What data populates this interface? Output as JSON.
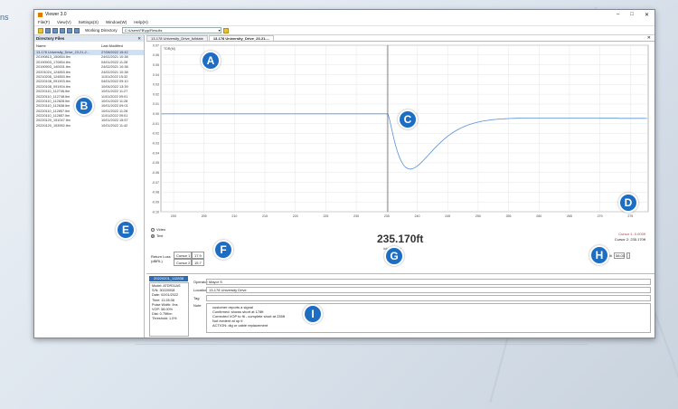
{
  "brand_fragment": "ns",
  "window": {
    "title": "Viewer 3.0",
    "controls": [
      "–",
      "□",
      "✕"
    ],
    "menu": [
      "File(F)",
      "View(V)",
      "Settings(S)",
      "Window(W)",
      "Help(H)"
    ],
    "working_dir_label": "Working Directory",
    "working_dir_value": "C:\\Users\\FB\\pp\\Results"
  },
  "sidebar": {
    "title": "Directory Files",
    "close": "✕",
    "col_name": "Name",
    "col_modified": "Last Modified",
    "files": [
      {
        "name": "13-178 University_Drive_23-21-2...",
        "date": "27/08/2022 15:42"
      },
      {
        "name": "20190813_150854.ltm",
        "date": "24/02/2021 10:38"
      },
      {
        "name": "20190903_170854.ltm",
        "date": "04/01/2022 11:28"
      },
      {
        "name": "20190903_140931.ltm",
        "date": "24/02/2021 10:38"
      },
      {
        "name": "20201024_124853.ltm",
        "date": "24/02/2021 10:38"
      },
      {
        "name": "20210206_124853.ltm",
        "date": "11/01/2022 15:32"
      },
      {
        "name": "20220108_091903.ltm",
        "date": "04/01/2022 09:10"
      },
      {
        "name": "20220108_091904.ltm",
        "date": "10/04/2022 13:39"
      },
      {
        "name": "20220110_112746.ltm",
        "date": "10/01/2022 11:27"
      },
      {
        "name": "20220110_112748.ltm",
        "date": "11/01/2022 09:01"
      },
      {
        "name": "20220110_112828.ltm",
        "date": "10/01/2022 11:28"
      },
      {
        "name": "20220110_112838.ltm",
        "date": "10/01/2022 09:01"
      },
      {
        "name": "20220110_112857.ltm",
        "date": "10/01/2022 11:28"
      },
      {
        "name": "20220110_112857.ltm",
        "date": "11/01/2022 09:01"
      },
      {
        "name": "20220120_151047.ltm",
        "date": "10/01/2022 15:57"
      },
      {
        "name": "20220120_153952.ltm",
        "date": "10/01/2022 11:42"
      }
    ]
  },
  "tabs": [
    {
      "label": "13-178 University_Drive_fulldate"
    },
    {
      "label": "13-178 University_Drive_23-21-..."
    }
  ],
  "tabs_close": "✕",
  "plot": {
    "corner_label": "TDR(M)",
    "y_ticks": [
      "0.07",
      "0.06",
      "0.05",
      "0.04",
      "0.03",
      "0.02",
      "0.01",
      "0.00",
      "-0.01",
      "-0.02",
      "-0.03",
      "-0.04",
      "-0.05",
      "-0.06",
      "-0.07",
      "-0.08",
      "-0.09",
      "-0.10"
    ],
    "x_ticks": [
      "200",
      "205",
      "210",
      "215",
      "220",
      "225",
      "230",
      "235",
      "240",
      "245",
      "250",
      "255",
      "260",
      "265",
      "270",
      "275",
      "280"
    ],
    "trace_color": "#5b8fd6",
    "cursor_x": 235.17
  },
  "controls": {
    "radio_video": "Video",
    "radio_text": "Text",
    "distance": "235.170ft",
    "distance_sub": "##.### ft/m",
    "cursor1_label": "Cursor 1:",
    "cursor1_value": "0.0039",
    "cursor2_label": "Cursor 2:",
    "cursor2_value": "235.170ft",
    "return_loss_label": "Return Loss",
    "return_loss_unit": "(dBRL)",
    "rl_c1": "Cursor 1",
    "rl_c1_val": "17.9",
    "rl_c2": "Cursor 2",
    "rl_c2_val": "15.7",
    "vop_label": "VOP ###",
    "vop_value": "58.00"
  },
  "bottom": {
    "tab_label": "20220201_112838",
    "info_lines": [
      "Model: ATDR31AS",
      "S/N: 30220008",
      "Date: 02/01/2022",
      "Time: 11:28:38",
      "Pulse Width: 9ns",
      "VOP: 58.00%",
      "Dist: 0.75ft/m",
      "Threshold: 1.0%"
    ],
    "operator_label": "Operator",
    "operator_value": "Mayor S",
    "location_label": "Location",
    "location_value": "13-178 University Drive",
    "tag_label": "Tag",
    "tag_value": "",
    "note_label": "Note",
    "note_lines": [
      "customer reports a signal",
      "Confirmed: shows short at 178ft",
      "Corrected VOP to fit - complete short at 235ft",
      "Not evident at up tl",
      "ACTION: dig or cable replacement"
    ]
  },
  "badges": [
    "A",
    "B",
    "C",
    "D",
    "E",
    "F",
    "G",
    "H",
    "I"
  ]
}
